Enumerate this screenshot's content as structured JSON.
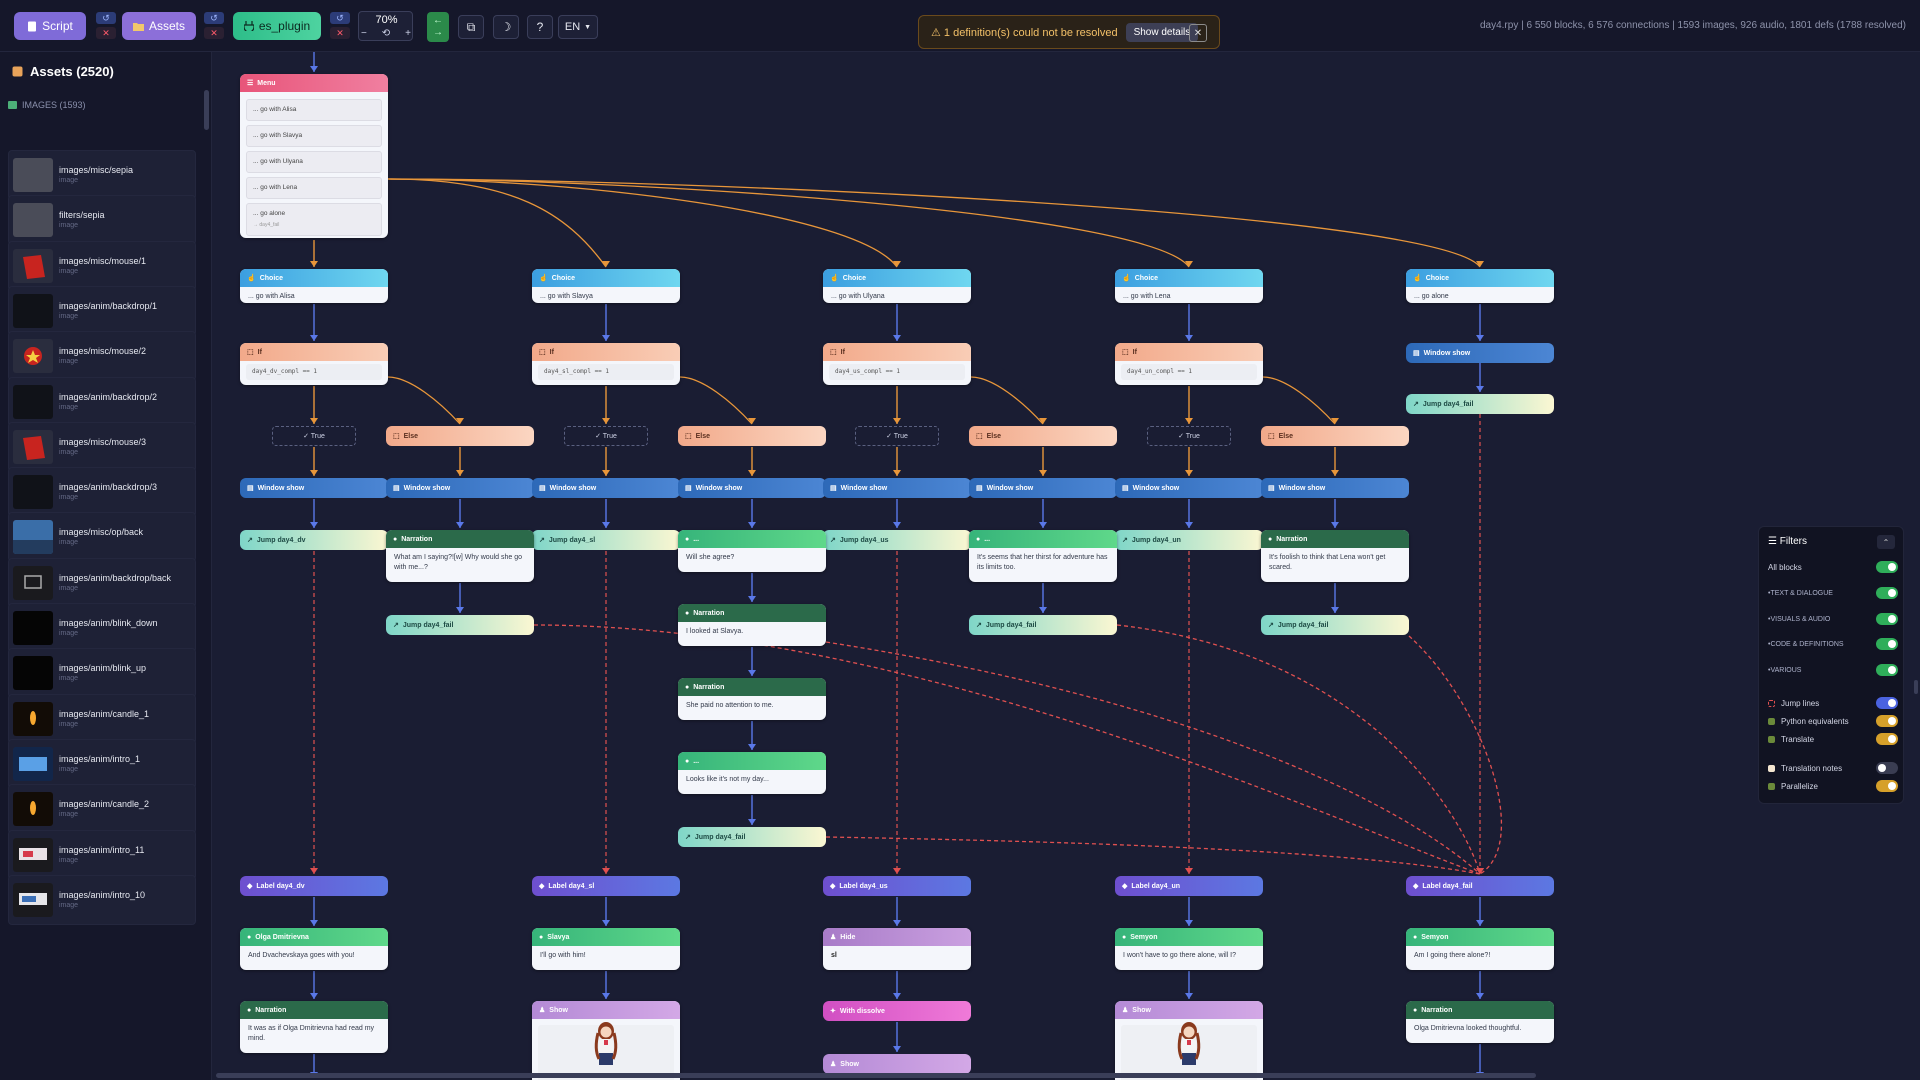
{
  "toolbar": {
    "script_label": "Script",
    "assets_label": "Assets",
    "plugin_label": "es_plugin",
    "zoom": "70%",
    "zoom_minus": "−",
    "zoom_reset": "⟲",
    "zoom_plus": "+",
    "lang": "EN",
    "help": "?",
    "warning_text": "⚠ 1 definition(s) could not be resolved",
    "show_details": "Show details",
    "stats": "day4.rpy | 6 550 blocks, 6 576 connections | 1593 images, 926 audio, 1801 defs (1788 resolved)"
  },
  "sidebar": {
    "title": "Assets (2520)",
    "section": "IMAGES (1593)",
    "items": [
      {
        "name": "images/misc/sepia",
        "type": "image"
      },
      {
        "name": "filters/sepia",
        "type": "image"
      },
      {
        "name": "images/misc/mouse/1",
        "type": "image"
      },
      {
        "name": "images/anim/backdrop/1",
        "type": "image"
      },
      {
        "name": "images/misc/mouse/2",
        "type": "image"
      },
      {
        "name": "images/anim/backdrop/2",
        "type": "image"
      },
      {
        "name": "images/misc/mouse/3",
        "type": "image"
      },
      {
        "name": "images/anim/backdrop/3",
        "type": "image"
      },
      {
        "name": "images/misc/op/back",
        "type": "image"
      },
      {
        "name": "images/anim/backdrop/back",
        "type": "image"
      },
      {
        "name": "images/anim/blink_down",
        "type": "image"
      },
      {
        "name": "images/anim/blink_up",
        "type": "image"
      },
      {
        "name": "images/anim/candle_1",
        "type": "image"
      },
      {
        "name": "images/anim/intro_1",
        "type": "image"
      },
      {
        "name": "images/anim/candle_2",
        "type": "image"
      },
      {
        "name": "images/anim/intro_11",
        "type": "image"
      },
      {
        "name": "images/anim/intro_10",
        "type": "image"
      }
    ]
  },
  "graph": {
    "menu": {
      "title": "Menu",
      "options": [
        "... go with Alisa",
        "... go with Slavya",
        "... go with Ulyana",
        "... go with Lena",
        "... go alone"
      ],
      "alone_sub": "→ day4_fail"
    },
    "choices": [
      "... go with Alisa",
      "... go with Slavya",
      "... go with Ulyana",
      "... go with Lena",
      "... go alone"
    ],
    "choice_title": "Choice",
    "if_title": "If",
    "conditions": [
      "day4_dv_compl == 1",
      "day4_sl_compl == 1",
      "day4_us_compl == 1",
      "day4_un_compl == 1"
    ],
    "true_label": "✓ True",
    "else_label": "Else",
    "window_show": "Window show",
    "narration": "Narration",
    "ellipsis": "...",
    "jumps": {
      "dv": "Jump day4_dv",
      "sl": "Jump day4_sl",
      "us": "Jump day4_us",
      "un": "Jump day4_un",
      "fail": "Jump day4_fail"
    },
    "texts": {
      "dv_else": "What am I saying?![w] Why would she go with me...?",
      "sl_1": "Will she agree?",
      "sl_2": "I looked at Slavya.",
      "sl_3": "She paid no attention to me.",
      "sl_4": "Looks like it's not my day...",
      "us_else": "It's seems that her thirst for adventure has its limits too.",
      "un_else": "It's foolish to think that Lena won't get scared."
    },
    "labels": {
      "dv": "Label day4_dv",
      "sl": "Label day4_sl",
      "us": "Label day4_us",
      "un": "Label day4_un",
      "fail": "Label day4_fail"
    },
    "bottom": {
      "dv_speaker": "Olga Dmitrievna",
      "dv_line": "And Dvachevskaya goes with you!",
      "dv_narr": "It was as if Olga Dmitrievna had read my mind.",
      "sl_speaker": "Slavya",
      "sl_line": "I'll go with him!",
      "show": "Show",
      "hide": "Hide",
      "hide_val": "sl",
      "with_dissolve": "With dissolve",
      "un_speaker": "Semyon",
      "un_line": "I won't have to go there alone, will I?",
      "fail_speaker": "Semyon",
      "fail_line": "Am I going there alone?!",
      "fail_narr": "Olga Dmitrievna looked thoughtful."
    }
  },
  "filters": {
    "title": "Filters",
    "rows": [
      {
        "label": "All blocks",
        "on": true,
        "color": "#2fae5a"
      },
      {
        "label": "•TEXT & DIALOGUE",
        "on": true,
        "color": "#2fae5a"
      },
      {
        "label": "•VISUALS & AUDIO",
        "on": true,
        "color": "#2fae5a"
      },
      {
        "label": "•CODE & DEFINITIONS",
        "on": true,
        "color": "#2fae5a"
      },
      {
        "label": "•VARIOUS",
        "on": true,
        "color": "#2fae5a"
      },
      {
        "label": "Jump lines",
        "on": true,
        "color": "#4b63e0"
      },
      {
        "label": "Python equivalents",
        "on": true,
        "color": "#d6a02a"
      },
      {
        "label": "Translate",
        "on": true,
        "color": "#d6a02a"
      },
      {
        "label": "Translation notes",
        "on": false,
        "color": "#3a3d52"
      },
      {
        "label": "Parallelize",
        "on": true,
        "color": "#d6a02a"
      }
    ]
  }
}
